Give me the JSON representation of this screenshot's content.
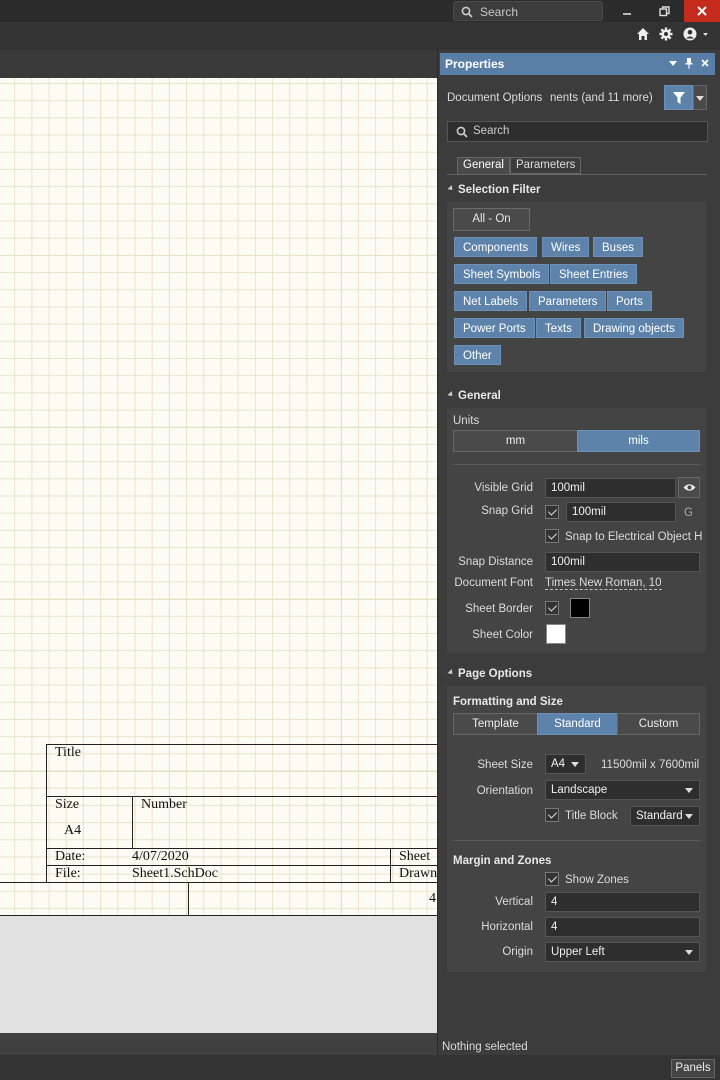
{
  "titlebar": {
    "search_placeholder": "Search"
  },
  "title_block": {
    "title_label": "Title",
    "size_label": "Size",
    "size_value": "A4",
    "number_label": "Number",
    "date_label": "Date:",
    "date_value": "4/07/2020",
    "file_label": "File:",
    "file_value": "Sheet1.SchDoc",
    "sheet_label": "Sheet",
    "drawn_label": "Drawn",
    "zone_label": "4"
  },
  "panel": {
    "title": "Properties",
    "filter_text": "Document Options",
    "filter_more": "nents (and 11 more)",
    "search_placeholder": "Search",
    "tabs": [
      {
        "label": "General"
      },
      {
        "label": "Parameters"
      }
    ],
    "selection_filter": {
      "header": "Selection Filter",
      "all_on": "All - On",
      "buttons": [
        {
          "label": "Components"
        },
        {
          "label": "Wires"
        },
        {
          "label": "Buses"
        },
        {
          "label": "Sheet Symbols"
        },
        {
          "label": "Sheet Entries"
        },
        {
          "label": "Net Labels"
        },
        {
          "label": "Parameters"
        },
        {
          "label": "Ports"
        },
        {
          "label": "Power Ports"
        },
        {
          "label": "Texts"
        },
        {
          "label": "Drawing objects"
        },
        {
          "label": "Other"
        }
      ]
    },
    "general": {
      "header": "General",
      "units_label": "Units",
      "units": [
        {
          "label": "mm"
        },
        {
          "label": "mils"
        }
      ],
      "visible_grid_label": "Visible Grid",
      "visible_grid_value": "100mil",
      "snap_grid_label": "Snap Grid",
      "snap_grid_value": "100mil",
      "snap_grid_key": "G",
      "snap_electrical_label": "Snap to Electrical Object H",
      "snap_distance_label": "Snap Distance",
      "snap_distance_value": "100mil",
      "document_font_label": "Document Font",
      "document_font_value": "Times New Roman, 10",
      "sheet_border_label": "Sheet Border",
      "sheet_border_color": "#000000",
      "sheet_color_label": "Sheet Color",
      "sheet_color": "#ffffff"
    },
    "page_options": {
      "header": "Page Options",
      "formatting_header": "Formatting and Size",
      "modes": [
        {
          "label": "Template"
        },
        {
          "label": "Standard"
        },
        {
          "label": "Custom"
        }
      ],
      "sheet_size_label": "Sheet Size",
      "sheet_size_value": "A4",
      "sheet_dims": "11500mil  x  7600mil",
      "orientation_label": "Orientation",
      "orientation_value": "Landscape",
      "title_block_label": "Title Block",
      "title_block_value": "Standard",
      "margin_header": "Margin and Zones",
      "show_zones_label": "Show Zones",
      "vertical_label": "Vertical",
      "vertical_value": "4",
      "horizontal_label": "Horizontal",
      "horizontal_value": "4",
      "origin_label": "Origin",
      "origin_value": "Upper Left"
    },
    "status": "Nothing selected"
  },
  "bottombar": {
    "panels_label": "Panels"
  },
  "colors": {
    "accent": "#5e83ab",
    "header": "#5a7fa6",
    "close": "#c42b1c",
    "sheet": "#fcfbf4"
  }
}
